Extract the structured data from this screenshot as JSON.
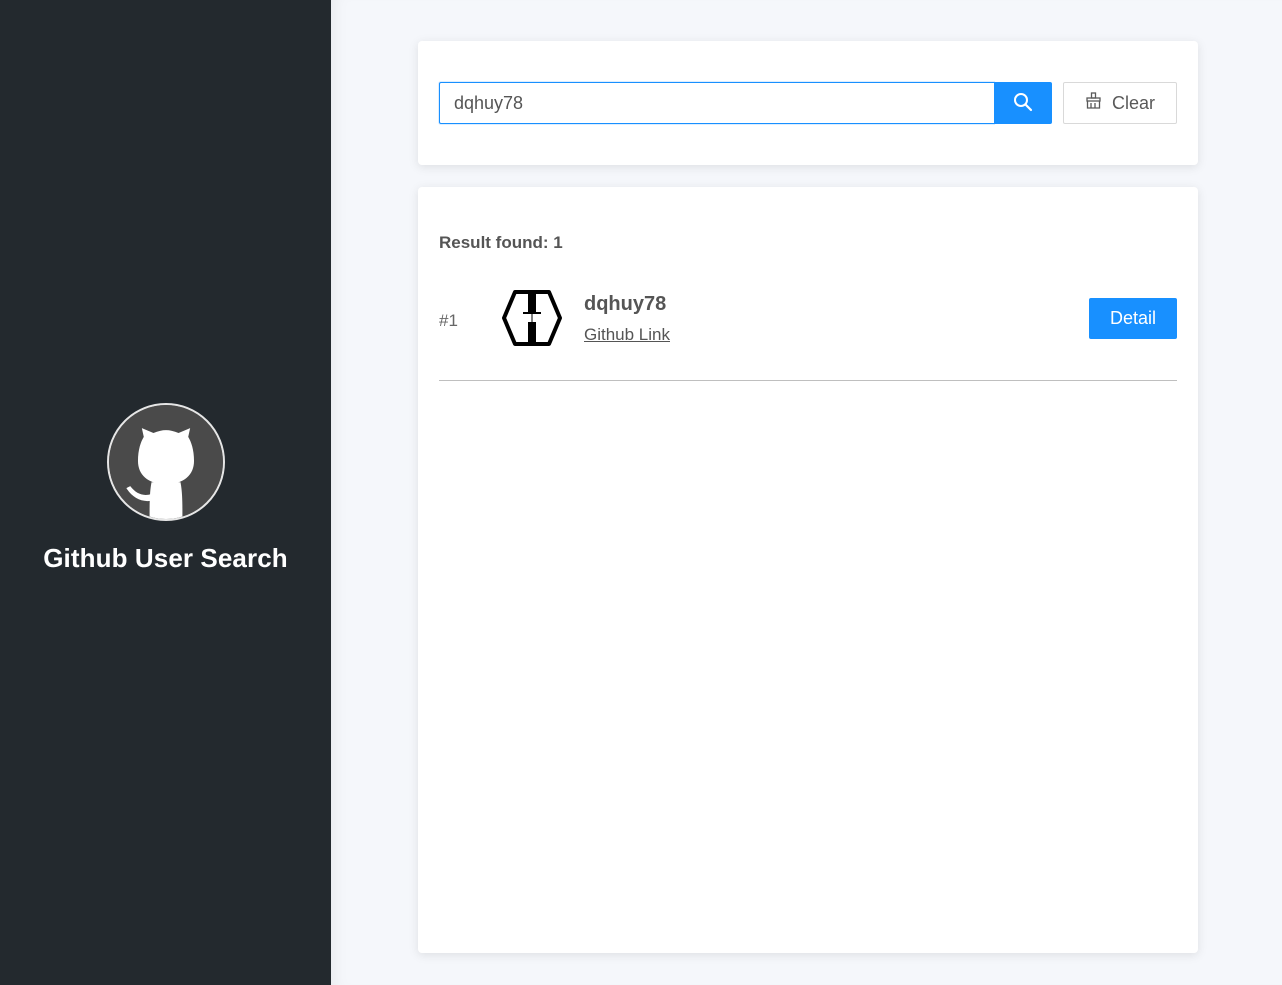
{
  "sidebar": {
    "logo_icon": "github-octocat-icon",
    "title": "Github User Search"
  },
  "search": {
    "value": "dqhuy78",
    "search_icon": "search-icon",
    "clear_icon": "clear-broom-icon",
    "clear_label": "Clear"
  },
  "results": {
    "count_text": "Result found: 1",
    "items": [
      {
        "rank": "#1",
        "avatar_icon": "user-avatar-icon",
        "username": "dqhuy78",
        "link_label": "Github Link",
        "detail_label": "Detail"
      }
    ]
  },
  "colors": {
    "sidebar_bg": "#23292e",
    "accent": "#1890ff",
    "page_bg": "#f5f7fb"
  }
}
